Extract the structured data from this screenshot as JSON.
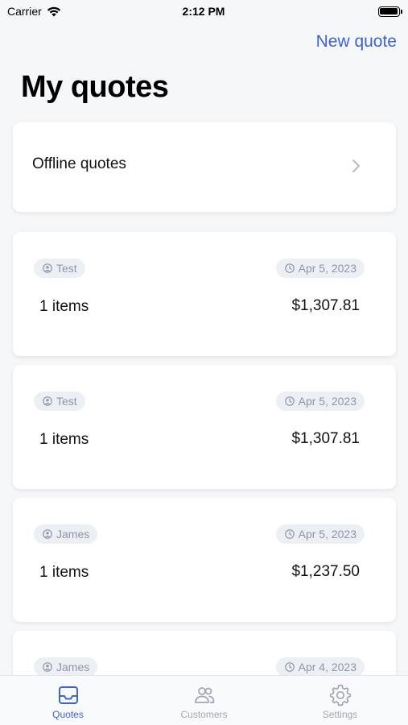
{
  "status": {
    "carrier": "Carrier",
    "time": "2:12 PM"
  },
  "nav": {
    "action": "New quote",
    "title": "My quotes"
  },
  "offline": {
    "label": "Offline quotes"
  },
  "quotes": [
    {
      "customer": "Test",
      "date": "Apr 5, 2023",
      "items": "1 items",
      "amount": "$1,307.81"
    },
    {
      "customer": "Test",
      "date": "Apr 5, 2023",
      "items": "1 items",
      "amount": "$1,307.81"
    },
    {
      "customer": "James",
      "date": "Apr 5, 2023",
      "items": "1 items",
      "amount": "$1,237.50"
    },
    {
      "customer": "James",
      "date": "Apr 4, 2023",
      "items": "",
      "amount": ""
    }
  ],
  "tabs": [
    {
      "label": "Quotes",
      "icon": "inbox-icon",
      "active": true
    },
    {
      "label": "Customers",
      "icon": "users-icon",
      "active": false
    },
    {
      "label": "Settings",
      "icon": "gear-icon",
      "active": false
    }
  ],
  "colors": {
    "accent": "#3e63d6",
    "pill_bg": "#eceff4",
    "pill_text": "#8d96a8",
    "background": "#f6f7f9"
  }
}
